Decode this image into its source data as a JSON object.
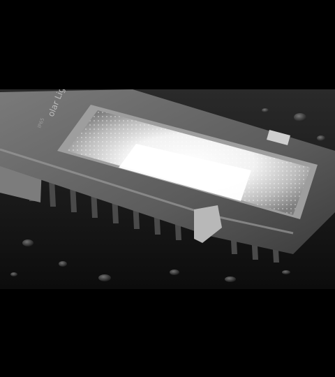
{
  "scene": {
    "subject": "solar-street-light-on-wet-surface",
    "housing_print": "olar Light",
    "housing_print_small": "IP65",
    "colors": {
      "background": "#000000",
      "wet_surface": "#141414",
      "housing": "#6b6b6b",
      "glow": "#ffffff"
    }
  }
}
